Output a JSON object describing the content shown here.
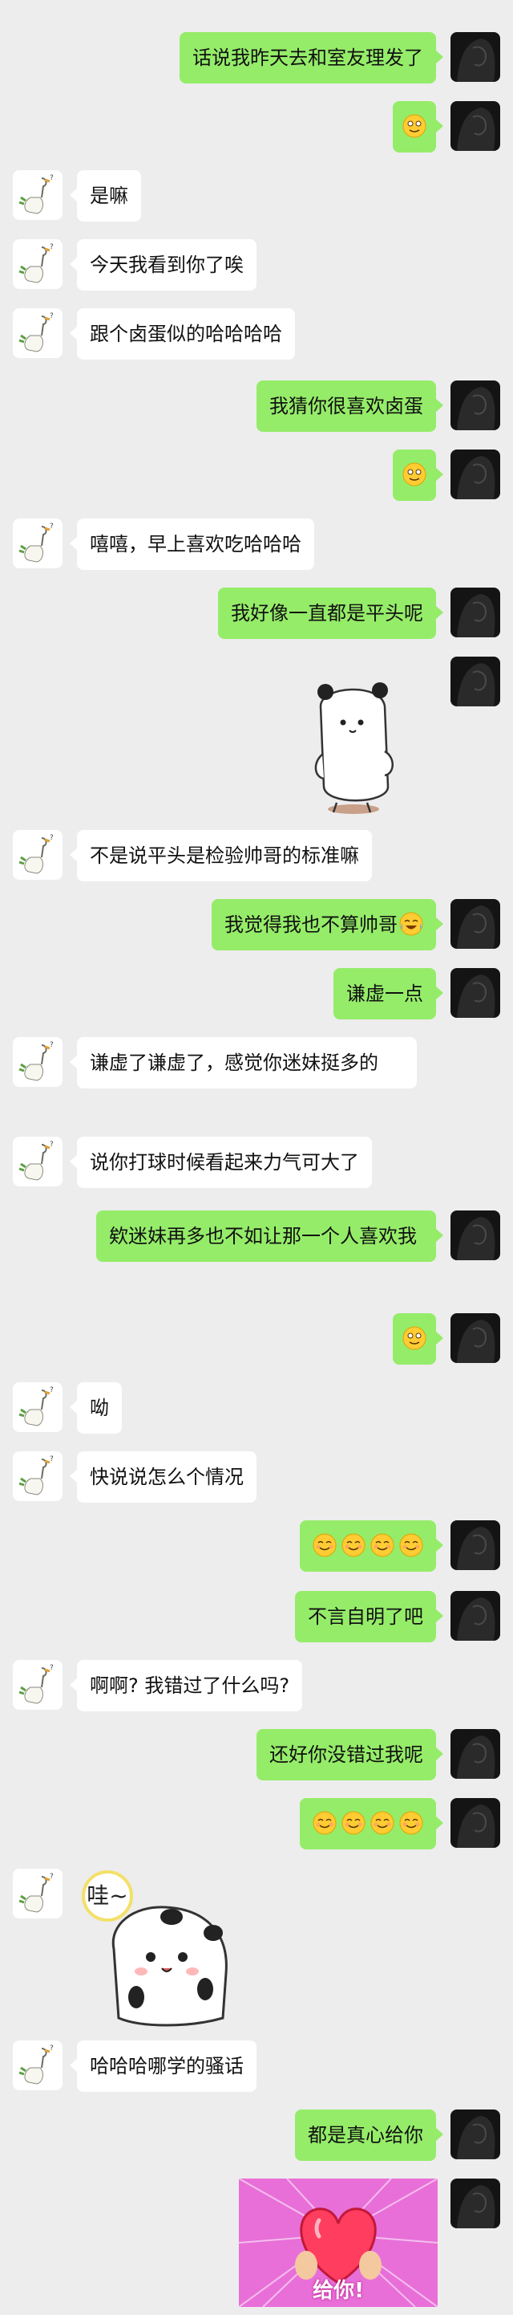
{
  "colors": {
    "background": "#ededed",
    "bubble_self": "#95ec69",
    "bubble_other": "#ffffff",
    "text": "#111111"
  },
  "messages": [
    {
      "side": "right",
      "text": "话说我昨天去和室友理发了"
    },
    {
      "side": "right",
      "emoji": [
        "awkward-smile-emoji"
      ]
    },
    {
      "side": "left",
      "text": "是嘛"
    },
    {
      "side": "left",
      "text": "今天我看到你了唉"
    },
    {
      "side": "left",
      "text": "跟个卤蛋似的哈哈哈哈"
    },
    {
      "side": "right",
      "text": "我猜你很喜欢卤蛋"
    },
    {
      "side": "right",
      "emoji": [
        "awkward-smile-emoji"
      ]
    },
    {
      "side": "left",
      "text": "嘻嘻，早上喜欢吃哈哈哈"
    },
    {
      "side": "right",
      "text": "我好像一直都是平头呢"
    },
    {
      "side": "right",
      "sticker": "panda-sticker"
    },
    {
      "side": "left",
      "text": "不是说平头是检验帅哥的标准嘛"
    },
    {
      "side": "right",
      "text": "我觉得我也不算帅哥",
      "trailing_emoji": "laugh-cry-emoji"
    },
    {
      "side": "right",
      "text": "谦虚一点"
    },
    {
      "side": "left",
      "text": "谦虚了谦虚了，感觉你迷妹挺多的"
    },
    {
      "side": "left",
      "text": "说你打球时候看起来力气可大了"
    },
    {
      "side": "right",
      "text": "欸迷妹再多也不如让那一个人喜欢我"
    },
    {
      "side": "right",
      "emoji": [
        "awkward-smile-emoji"
      ]
    },
    {
      "side": "left",
      "text": "呦"
    },
    {
      "side": "left",
      "text": "快说说怎么个情况"
    },
    {
      "side": "right",
      "emoji": [
        "smile-emoji",
        "smile-emoji",
        "smile-emoji",
        "smile-emoji"
      ]
    },
    {
      "side": "right",
      "text": "不言自明了吧"
    },
    {
      "side": "left",
      "text": "啊啊? 我错过了什么吗?"
    },
    {
      "side": "right",
      "text": "还好你没错过我呢"
    },
    {
      "side": "right",
      "emoji": [
        "smile-emoji",
        "smile-emoji",
        "smile-emoji",
        "smile-emoji"
      ]
    },
    {
      "side": "left",
      "sticker": "panda-wa-sticker",
      "sticker_text": "哇~"
    },
    {
      "side": "left",
      "text": "哈哈哈哪学的骚话"
    },
    {
      "side": "right",
      "text": "都是真心给你"
    },
    {
      "side": "right",
      "sticker": "heart-gift-sticker",
      "sticker_text": "给你!"
    }
  ]
}
